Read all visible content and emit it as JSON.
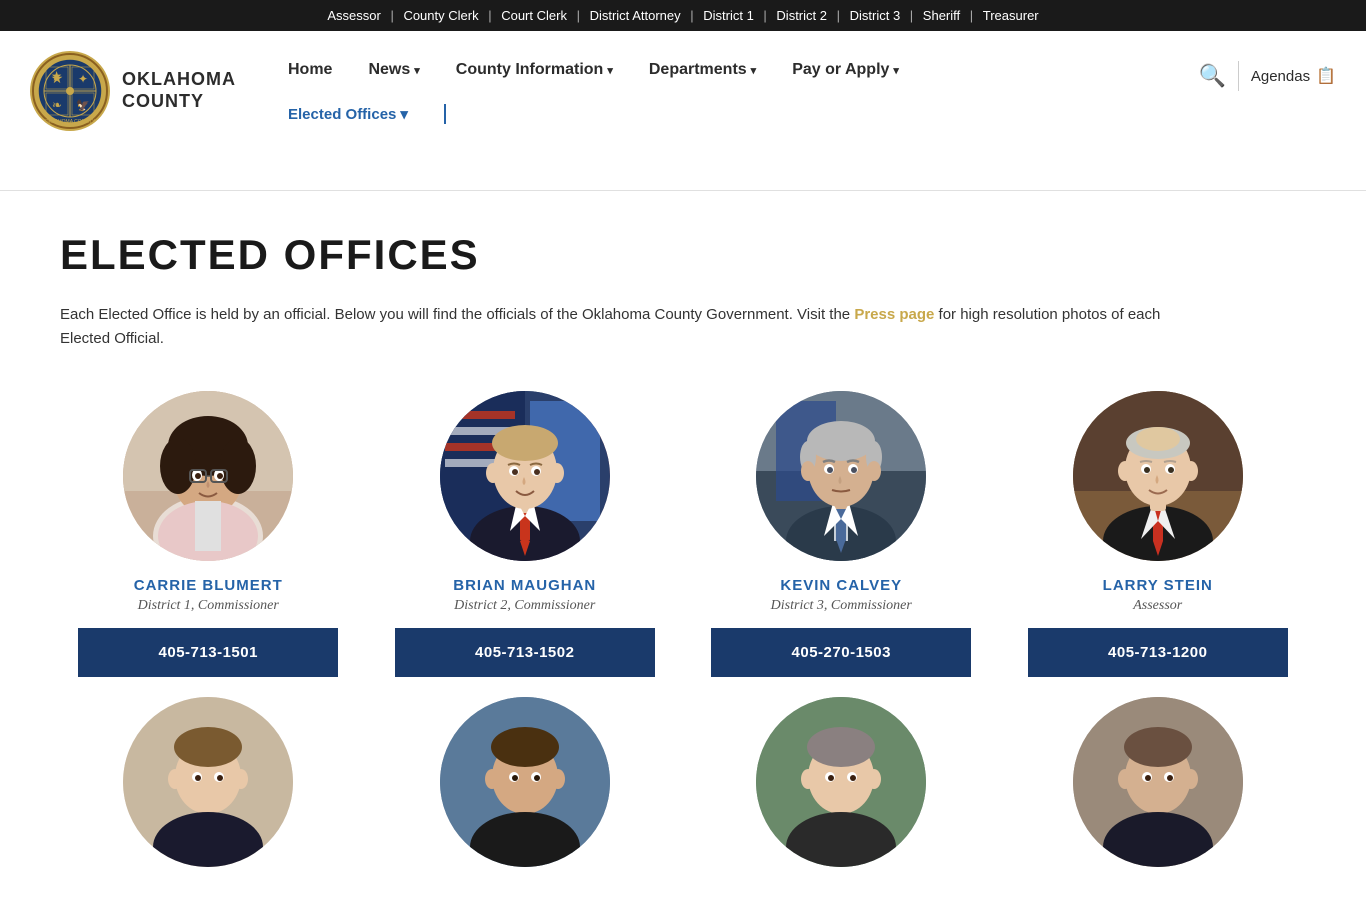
{
  "topbar": {
    "links": [
      {
        "label": "Assessor",
        "href": "#"
      },
      {
        "label": "County Clerk",
        "href": "#"
      },
      {
        "label": "Court Clerk",
        "href": "#"
      },
      {
        "label": "District Attorney",
        "href": "#"
      },
      {
        "label": "District 1",
        "href": "#"
      },
      {
        "label": "District 2",
        "href": "#"
      },
      {
        "label": "District 3",
        "href": "#"
      },
      {
        "label": "Sheriff",
        "href": "#"
      },
      {
        "label": "Treasurer",
        "href": "#"
      }
    ]
  },
  "header": {
    "logo_text_line1": "OKLAHOMA",
    "logo_text_line2": "COUNTY",
    "nav": {
      "home": "Home",
      "news": "News",
      "county_info": "County Information",
      "departments": "Departments",
      "pay_or_apply": "Pay or Apply",
      "elected_offices": "Elected Offices"
    },
    "agendas": "Agendas"
  },
  "page": {
    "title": "ELECTED OFFICES",
    "intro": "Each Elected Office is held by an official. Below you will find the officials of the Oklahoma County Government. Visit the ",
    "press_page_link": "Press page",
    "intro_end": " for high resolution photos of each Elected Official."
  },
  "officials": [
    {
      "name": "CARRIE BLUMERT",
      "role": "District 1, Commissioner",
      "phone": "405-713-1501",
      "photo_class": "photo-blumert"
    },
    {
      "name": "BRIAN MAUGHAN",
      "role": "District 2, Commissioner",
      "phone": "405-713-1502",
      "photo_class": "photo-maughan"
    },
    {
      "name": "KEVIN CALVEY",
      "role": "District 3, Commissioner",
      "phone": "405-270-1503",
      "photo_class": "photo-calvey"
    },
    {
      "name": "LARRY STEIN",
      "role": "Assessor",
      "phone": "405-713-1200",
      "photo_class": "photo-stein"
    }
  ],
  "bottom_row": [
    {
      "photo_class": "photo-p2"
    },
    {
      "photo_class": "photo-p3"
    },
    {
      "photo_class": "photo-p4"
    },
    {
      "photo_class": "photo-p5"
    }
  ]
}
